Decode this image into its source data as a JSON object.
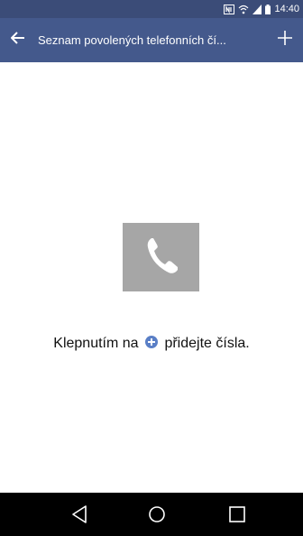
{
  "status_bar": {
    "time": "14:40",
    "icons": [
      "nfc-icon",
      "wifi-signal-icon",
      "cell-signal-icon",
      "battery-icon"
    ]
  },
  "app_bar": {
    "title": "Seznam povolených telefonních čí...",
    "back_icon": "arrow-left-icon",
    "add_icon": "plus-icon",
    "color": "#44598c"
  },
  "empty_state": {
    "icon": "phone-icon",
    "text_before": "Klepnutím na",
    "inline_icon": "add-circle-icon",
    "text_after": "přidejte čísla."
  },
  "nav_bar": {
    "buttons": [
      "back-triangle-icon",
      "home-circle-icon",
      "recent-square-icon"
    ]
  }
}
